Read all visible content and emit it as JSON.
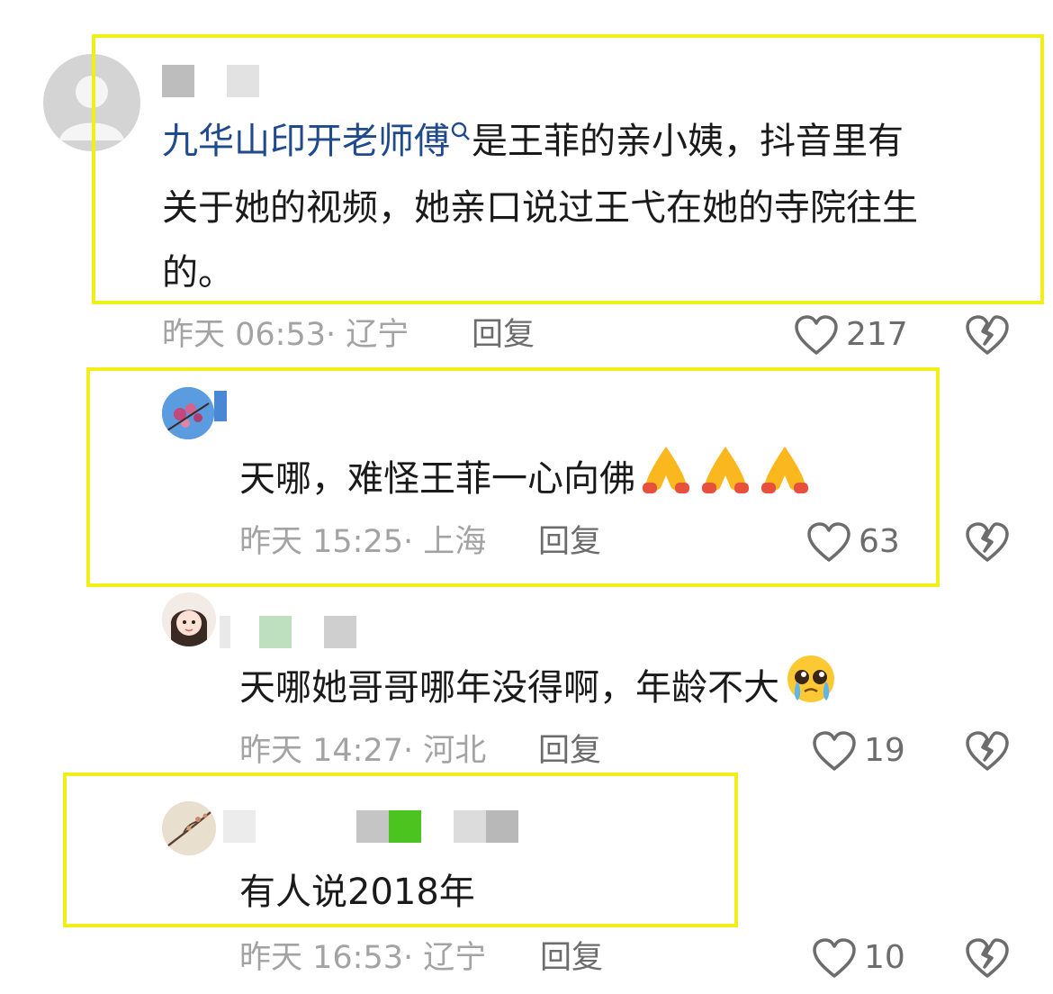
{
  "comments": [
    {
      "mention": "九华山印开老师傅",
      "text_line1": "是王菲的亲小姨，抖音里有",
      "text_line2": "关于她的视频，她亲口说过王弋在她的寺院往生",
      "text_line3": "的。",
      "time": "昨天 06:53",
      "location": "· 辽宁",
      "reply_label": "回复",
      "likes": "217"
    },
    {
      "text": "天哪，难怪王菲一心向佛",
      "emoji": "folded-hands",
      "time": "昨天 15:25",
      "location": "· 上海",
      "reply_label": "回复",
      "likes": "63"
    },
    {
      "text": "天哪她哥哥哪年没得啊，年龄不大",
      "emoji": "pleading-face",
      "time": "昨天 14:27",
      "location": "· 河北",
      "reply_label": "回复",
      "likes": "19"
    },
    {
      "text": "有人说2018年",
      "time": "昨天 16:53",
      "location": "· 辽宁",
      "reply_label": "回复",
      "likes": "10"
    }
  ],
  "colors": {
    "highlight": "#f2ee1a",
    "mention": "#1f4a8c",
    "meta": "#a3a3a3",
    "icon": "#6c6c6c"
  },
  "icons": [
    "search-icon",
    "heart-icon",
    "broken-heart-icon",
    "folded-hands-emoji",
    "pleading-face-emoji"
  ]
}
